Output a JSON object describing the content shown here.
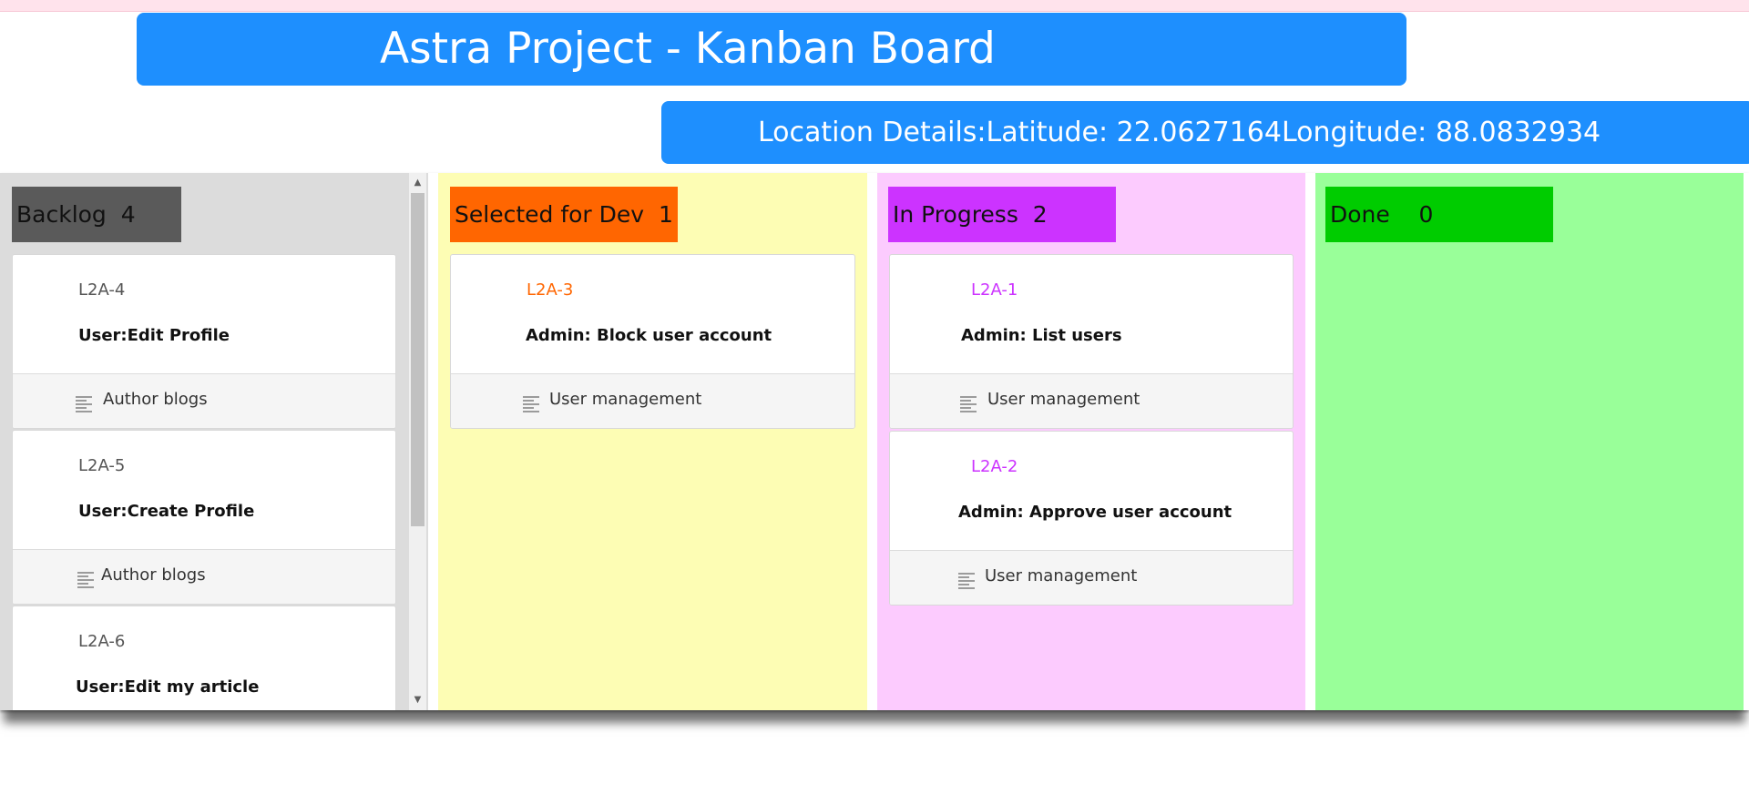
{
  "app": {
    "title": "Astra Project - Kanban Board",
    "location": "Location Details:Latitude: 22.0627164Longitude: 88.0832934"
  },
  "colors": {
    "title_bar": "#1e8ffe",
    "backlog_bg": "#dcdcdc",
    "backlog_header": "#5a5a5a",
    "selected_bg": "#fdfdb4",
    "selected_header": "#ff6601",
    "in_progress_bg": "#fccbfe",
    "in_progress_header": "#cc33ff",
    "done_bg": "#99ff99",
    "done_header": "#00cc00"
  },
  "columns": [
    {
      "name": "Backlog",
      "count": "4",
      "header_text": "Backlog  4",
      "cards": [
        {
          "key": "L2A-4",
          "summary": "User:Edit Profile",
          "epic": "Author blogs",
          "epic_icon": "epic-lines-icon"
        },
        {
          "key": "L2A-5",
          "summary": "User:Create Profile",
          "epic": "Author blogs",
          "epic_icon": "epic-lines-icon"
        },
        {
          "key": "L2A-6",
          "summary": "User:Edit my article",
          "epic": "",
          "epic_icon": "epic-lines-icon"
        }
      ]
    },
    {
      "name": "Selected for Dev",
      "count": "1",
      "header_text": "Selected for Dev  1",
      "cards": [
        {
          "key": "L2A-3",
          "summary": "Admin: Block user account",
          "epic": "User management",
          "epic_icon": "epic-lines-icon"
        }
      ]
    },
    {
      "name": "In Progress",
      "count": "2",
      "header_text": "In Progress  2",
      "cards": [
        {
          "key": "L2A-1",
          "summary": "Admin: List users",
          "epic": "User management",
          "epic_icon": "epic-lines-icon"
        },
        {
          "key": "L2A-2",
          "summary": "Admin: Approve user account",
          "epic": "User management",
          "epic_icon": "epic-lines-icon"
        }
      ]
    },
    {
      "name": "Done",
      "count": "0",
      "header_text": "Done    0",
      "cards": []
    }
  ]
}
